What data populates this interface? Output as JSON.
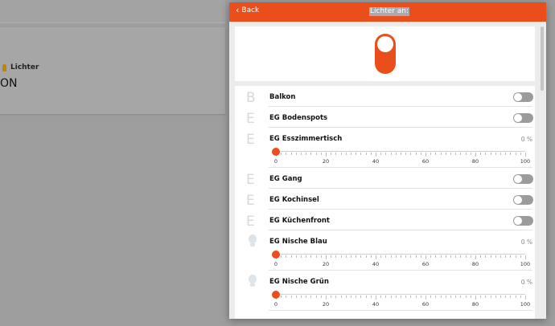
{
  "background": {
    "card_title": "Lichter",
    "card_value": "ON"
  },
  "dialog": {
    "back_label": "Back",
    "title": "Lichter an:",
    "main_toggle_on": true
  },
  "slider_ticks": [
    "0",
    "20",
    "40",
    "60",
    "80",
    "100"
  ],
  "items": [
    {
      "letter": "B",
      "name": "Balkon",
      "type": "switch",
      "on": false
    },
    {
      "letter": "E",
      "name": "EG Bodenspots",
      "type": "switch",
      "on": false
    },
    {
      "letter": "E",
      "name": "EG Esszimmertisch",
      "type": "dimmer",
      "percent_label": "0 %",
      "value": 0
    },
    {
      "letter": "E",
      "name": "EG Gang",
      "type": "switch",
      "on": false
    },
    {
      "letter": "E",
      "name": "EG Kochinsel",
      "type": "switch",
      "on": false
    },
    {
      "letter": "E",
      "name": "EG Küchenfront",
      "type": "switch",
      "on": false
    },
    {
      "icon": "lightbulb-icon",
      "name": "EG Nische Blau",
      "type": "dimmer",
      "percent_label": "0 %",
      "value": 0
    },
    {
      "icon": "lightbulb-icon",
      "name": "EG Nische Grün",
      "type": "dimmer",
      "percent_label": "0 %",
      "value": 0
    }
  ],
  "colors": {
    "accent": "#e94e1b",
    "switch_off": "#9b9b9b"
  }
}
